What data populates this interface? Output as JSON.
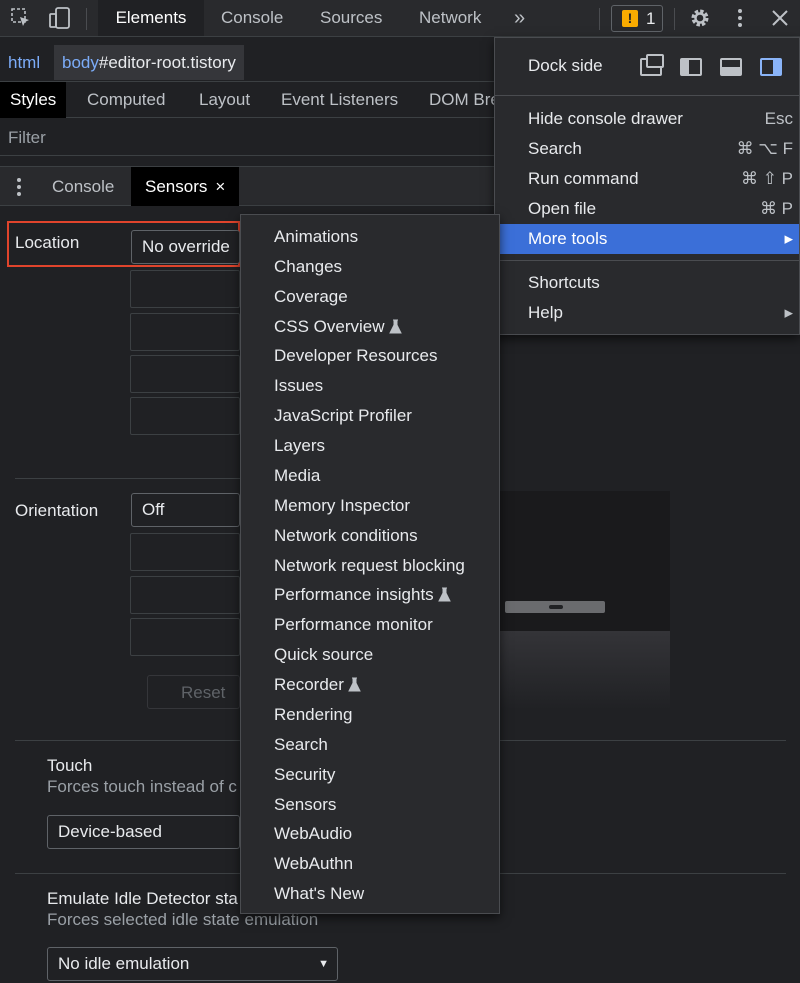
{
  "toolbar": {
    "tabs": [
      "Elements",
      "Console",
      "Sources",
      "Network"
    ],
    "more_tabs_glyph": "»",
    "issues_count": "1"
  },
  "breadcrumb": {
    "html": "html",
    "body_tag": "body",
    "body_id": "#editor-root.tistory"
  },
  "styles_tabs": [
    "Styles",
    "Computed",
    "Layout",
    "Event Listeners",
    "DOM Bre"
  ],
  "filter": {
    "placeholder": "Filter"
  },
  "drawer": {
    "tabs": [
      "Console",
      "Sensors"
    ],
    "close_glyph": "×"
  },
  "sensors": {
    "location_label": "Location",
    "location_value": "No override",
    "orientation_label": "Orientation",
    "orientation_value": "Off",
    "reset_label": "Reset",
    "touch_title": "Touch",
    "touch_desc": "Forces touch instead of c",
    "touch_value": "Device-based",
    "idle_title": "Emulate Idle Detector sta",
    "idle_desc": "Forces selected idle state emulation",
    "idle_value": "No idle emulation"
  },
  "main_menu": {
    "dock_side_label": "Dock side",
    "items": [
      {
        "label": "Hide console drawer",
        "shortcut": "Esc"
      },
      {
        "label": "Search",
        "shortcut": "⌘ ⌥ F"
      },
      {
        "label": "Run command",
        "shortcut": "⌘ ⇧ P"
      },
      {
        "label": "Open file",
        "shortcut": "⌘ P"
      },
      {
        "label": "More tools",
        "shortcut": "▸"
      }
    ],
    "items2": [
      {
        "label": "Shortcuts",
        "shortcut": ""
      },
      {
        "label": "Help",
        "shortcut": "▸"
      }
    ]
  },
  "more_tools": [
    {
      "label": "Animations"
    },
    {
      "label": "Changes"
    },
    {
      "label": "Coverage"
    },
    {
      "label": "CSS Overview",
      "experimental": true
    },
    {
      "label": "Developer Resources"
    },
    {
      "label": "Issues"
    },
    {
      "label": "JavaScript Profiler"
    },
    {
      "label": "Layers"
    },
    {
      "label": "Media"
    },
    {
      "label": "Memory Inspector"
    },
    {
      "label": "Network conditions"
    },
    {
      "label": "Network request blocking"
    },
    {
      "label": "Performance insights",
      "experimental": true
    },
    {
      "label": "Performance monitor"
    },
    {
      "label": "Quick source"
    },
    {
      "label": "Recorder",
      "experimental": true
    },
    {
      "label": "Rendering"
    },
    {
      "label": "Search"
    },
    {
      "label": "Security"
    },
    {
      "label": "Sensors"
    },
    {
      "label": "WebAudio"
    },
    {
      "label": "WebAuthn"
    },
    {
      "label": "What's New"
    }
  ],
  "colors": {
    "highlight": "#3b6fd8",
    "location_outline": "#e0442c",
    "issues_badge": "#f9ab00"
  }
}
